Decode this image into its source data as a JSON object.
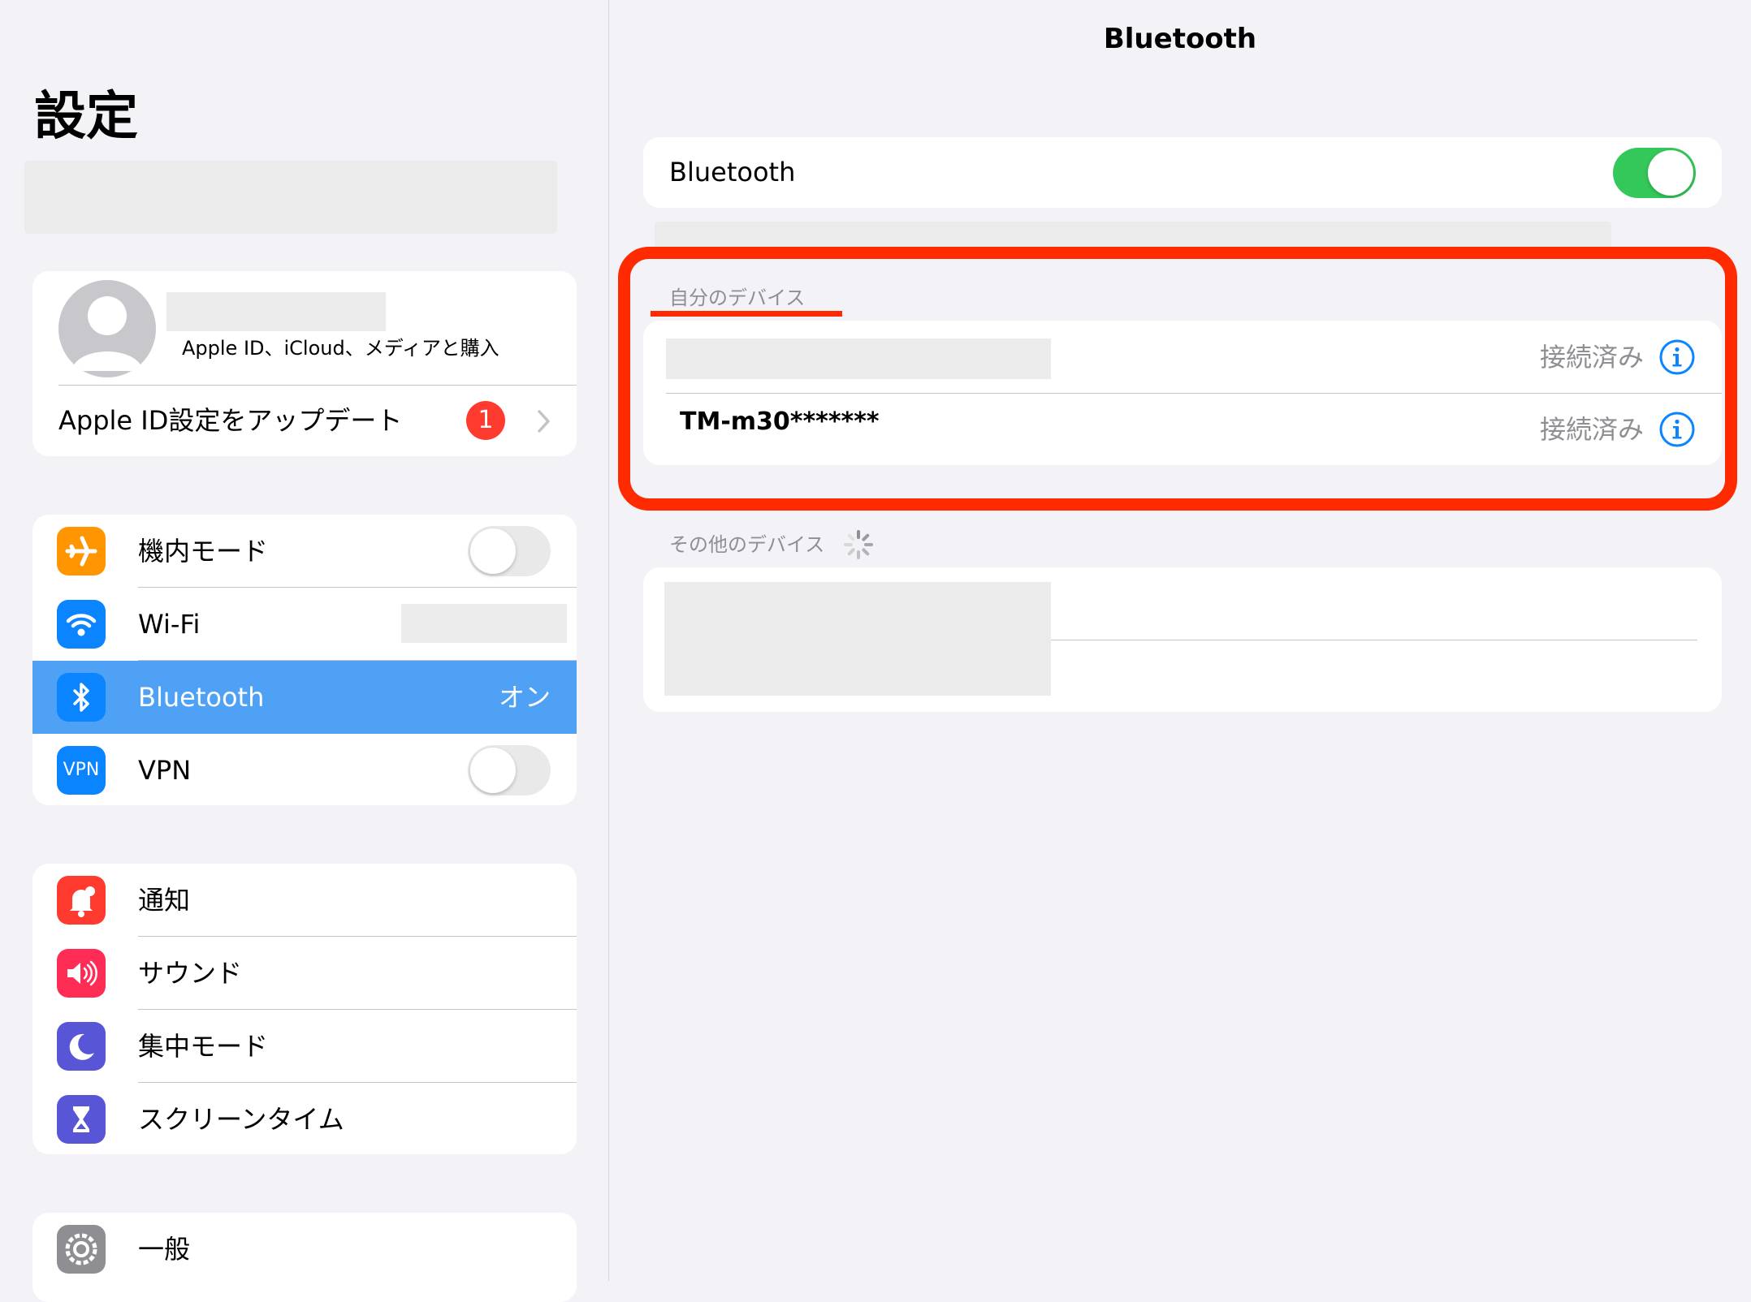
{
  "sidebar": {
    "title": "設定",
    "apple_id": {
      "subtitle": "Apple ID、iCloud、メディアと購入",
      "update_label": "Apple ID設定をアップデート",
      "badge_count": "1",
      "avatar_icon": "person-silhouette-icon"
    },
    "connectivity": [
      {
        "id": "airplane",
        "label": "機内モード",
        "icon": "airplane-icon",
        "color": "#ff9500",
        "toggle": "off"
      },
      {
        "id": "wifi",
        "label": "Wi-Fi",
        "icon": "wifi-icon",
        "color": "#0a84ff"
      },
      {
        "id": "bluetooth",
        "label": "Bluetooth",
        "icon": "bluetooth-icon",
        "color": "#0a84ff",
        "value": "オン",
        "selected": true
      },
      {
        "id": "vpn",
        "label": "VPN",
        "icon": "vpn-icon",
        "icon_text": "VPN",
        "color": "#0a84ff",
        "toggle": "off"
      }
    ],
    "notifications": [
      {
        "id": "notifications",
        "label": "通知",
        "icon": "bell-icon",
        "color": "#ff3b30"
      },
      {
        "id": "sound",
        "label": "サウンド",
        "icon": "speaker-icon",
        "color": "#ff2d55"
      },
      {
        "id": "focus",
        "label": "集中モード",
        "icon": "moon-icon",
        "color": "#5856d6"
      },
      {
        "id": "screentime",
        "label": "スクリーンタイム",
        "icon": "hourglass-icon",
        "color": "#5856d6"
      }
    ],
    "general": [
      {
        "id": "general",
        "label": "一般",
        "icon": "gear-icon",
        "color": "#8e8e93"
      }
    ]
  },
  "detail": {
    "nav_title": "Bluetooth",
    "bluetooth_row": {
      "label": "Bluetooth",
      "toggle": "on"
    },
    "my_devices_header": "自分のデバイス",
    "my_devices": [
      {
        "name": "",
        "status": "接続済み"
      },
      {
        "name": "TM-m30*******",
        "status": "接続済み"
      }
    ],
    "other_devices_header": "その他のデバイス"
  },
  "colors": {
    "accent": "#0a84ff",
    "annotation_red": "#ff2a00",
    "toggle_on": "#34c759",
    "badge_red": "#ff3b30"
  }
}
